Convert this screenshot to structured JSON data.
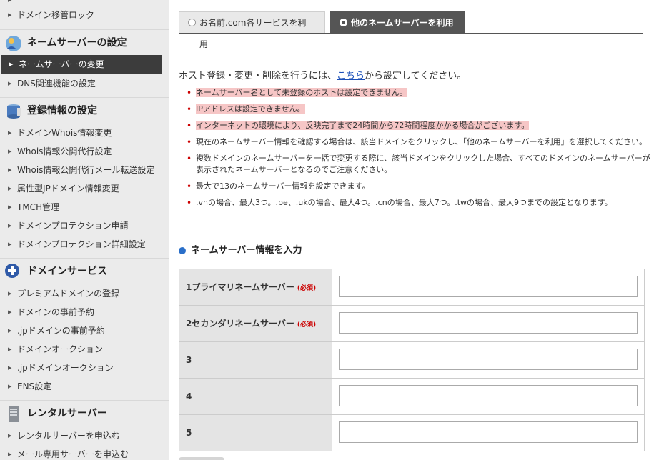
{
  "sidebar": {
    "items_top": [
      {
        "label": "ドメイン移管ロック"
      }
    ],
    "sections": [
      {
        "title": "ネームサーバーの設定",
        "icon": "user-globe-icon",
        "items": [
          {
            "label": "ネームサーバーの変更"
          },
          {
            "label": "DNS関連機能の設定"
          }
        ]
      },
      {
        "title": "登録情報の設定",
        "icon": "database-icon",
        "items": [
          {
            "label": "ドメインWhois情報変更"
          },
          {
            "label": "Whois情報公開代行設定"
          },
          {
            "label": "Whois情報公開代行メール転送設定"
          },
          {
            "label": "属性型JPドメイン情報変更"
          },
          {
            "label": "TMCH管理"
          },
          {
            "label": "ドメインプロテクション申請"
          },
          {
            "label": "ドメインプロテクション詳細設定"
          }
        ]
      },
      {
        "title": "ドメインサービス",
        "icon": "plus-circle-icon",
        "items": [
          {
            "label": "プレミアムドメインの登録"
          },
          {
            "label": "ドメインの事前予約"
          },
          {
            "label": ".jpドメインの事前予約"
          },
          {
            "label": "ドメインオークション"
          },
          {
            "label": ".jpドメインオークション"
          },
          {
            "label": "ENS設定"
          }
        ]
      },
      {
        "title": "レンタルサーバー",
        "icon": "server-icon",
        "items": [
          {
            "label": "レンタルサーバーを申込む"
          },
          {
            "label": "メール専用サーバーを申込む"
          }
        ]
      }
    ]
  },
  "tabs": [
    {
      "label": "お名前.com各サービスを利用",
      "selected": false
    },
    {
      "label": "他のネームサーバーを利用",
      "selected": true
    }
  ],
  "intro": {
    "before": "ホスト登録・変更・削除を行うには、",
    "link": "こちら",
    "after": "から設定してください。"
  },
  "notes": [
    "ネームサーバー名として未登録のホストは設定できません。",
    "IPアドレスは設定できません。",
    "インターネットの環境により、反映完了まで24時間から72時間程度かかる場合がございます。",
    "現在のネームサーバー情報を確認する場合は、該当ドメインをクリックし、「他のネームサーバーを利用」を選択してください。",
    "複数ドメインのネームサーバーを一括で変更する際に、該当ドメインをクリックした場合、すべてのドメインのネームサーバーが表示されたネームサーバーとなるのでご注意ください。",
    "最大で13のネームサーバー情報を設定できます。",
    ".vnの場合、最大3つ。.be、.ukの場合、最大4つ。.cnの場合、最大7つ。.twの場合、最大9つまでの設定となります。"
  ],
  "section_title": "ネームサーバー情報を入力",
  "required_label": "(必須)",
  "rows": [
    {
      "label": "1プライマリネームサーバー",
      "required": true,
      "value": ""
    },
    {
      "label": "2セカンダリネームサーバー",
      "required": true,
      "value": ""
    },
    {
      "label": "3",
      "required": false,
      "value": ""
    },
    {
      "label": "4",
      "required": false,
      "value": ""
    },
    {
      "label": "5",
      "required": false,
      "value": ""
    }
  ],
  "colors": {
    "active_tab": "#555555",
    "sidebar_bg": "#ebebeb",
    "required": "#cc0000",
    "highlight": "#f6c6c6",
    "link": "#1a4fb8"
  }
}
